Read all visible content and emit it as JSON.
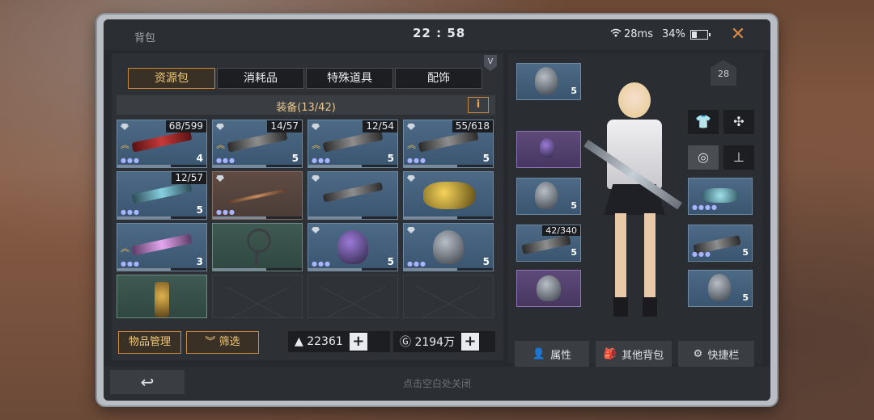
{
  "status": {
    "title": "背包",
    "time": "22 : 58",
    "ping": "28ms",
    "battery": "34%"
  },
  "tabs": [
    "资源包",
    "消耗品",
    "特殊道具",
    "配饰"
  ],
  "vip_label": "V",
  "equipment": {
    "title": "装备(13/42)",
    "info_label": "i"
  },
  "grid_items": [
    {
      "count": "68/599",
      "level": "4"
    },
    {
      "count": "14/57",
      "level": "5"
    },
    {
      "count": "12/54",
      "level": "5"
    },
    {
      "count": "55/618",
      "level": "5"
    },
    {
      "count": "12/57",
      "level": "5"
    },
    {
      "count": "",
      "level": ""
    },
    {
      "count": "",
      "level": ""
    },
    {
      "count": "",
      "level": ""
    },
    {
      "count": "",
      "level": "3"
    },
    {
      "count": "",
      "level": ""
    },
    {
      "count": "",
      "level": "5"
    },
    {
      "count": "",
      "level": "5"
    },
    {
      "count": "",
      "level": ""
    }
  ],
  "buttons": {
    "manage": "物品管理",
    "filter": "筛选"
  },
  "currency": {
    "gold": "22361",
    "coins": "2194万"
  },
  "equip_slots": {
    "helmet_level": "5",
    "armor_level": "5",
    "weapon_count": "42/340",
    "weapon_level": "5",
    "right_weapon_level": "5",
    "right_armor_level": "5"
  },
  "house_level": "28",
  "actions": {
    "attributes": "属性",
    "other_bags": "其他背包",
    "quickbar": "快捷栏"
  },
  "footer_hint": "点击空白处关闭"
}
